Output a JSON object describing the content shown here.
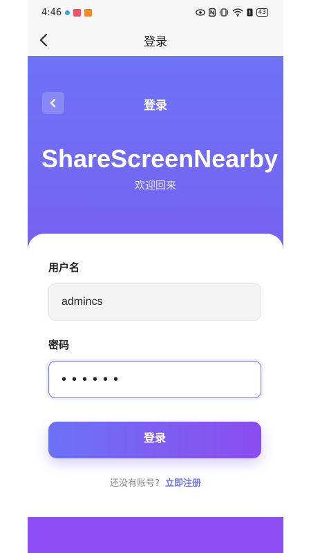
{
  "status_bar": {
    "time": "4:46",
    "battery": "43"
  },
  "nav": {
    "title": "登录"
  },
  "hero": {
    "title": "登录",
    "app_name": "ShareScreenNearby",
    "subtitle": "欢迎回来"
  },
  "form": {
    "username_label": "用户名",
    "username_value": "admincs",
    "password_label": "密码",
    "password_value": "••••••",
    "login_button": "登录"
  },
  "footer": {
    "no_account_text": "还没有账号?",
    "register_link": "立即注册"
  },
  "colors": {
    "primary": "#6c72f5",
    "accent": "#8b4cf0"
  }
}
